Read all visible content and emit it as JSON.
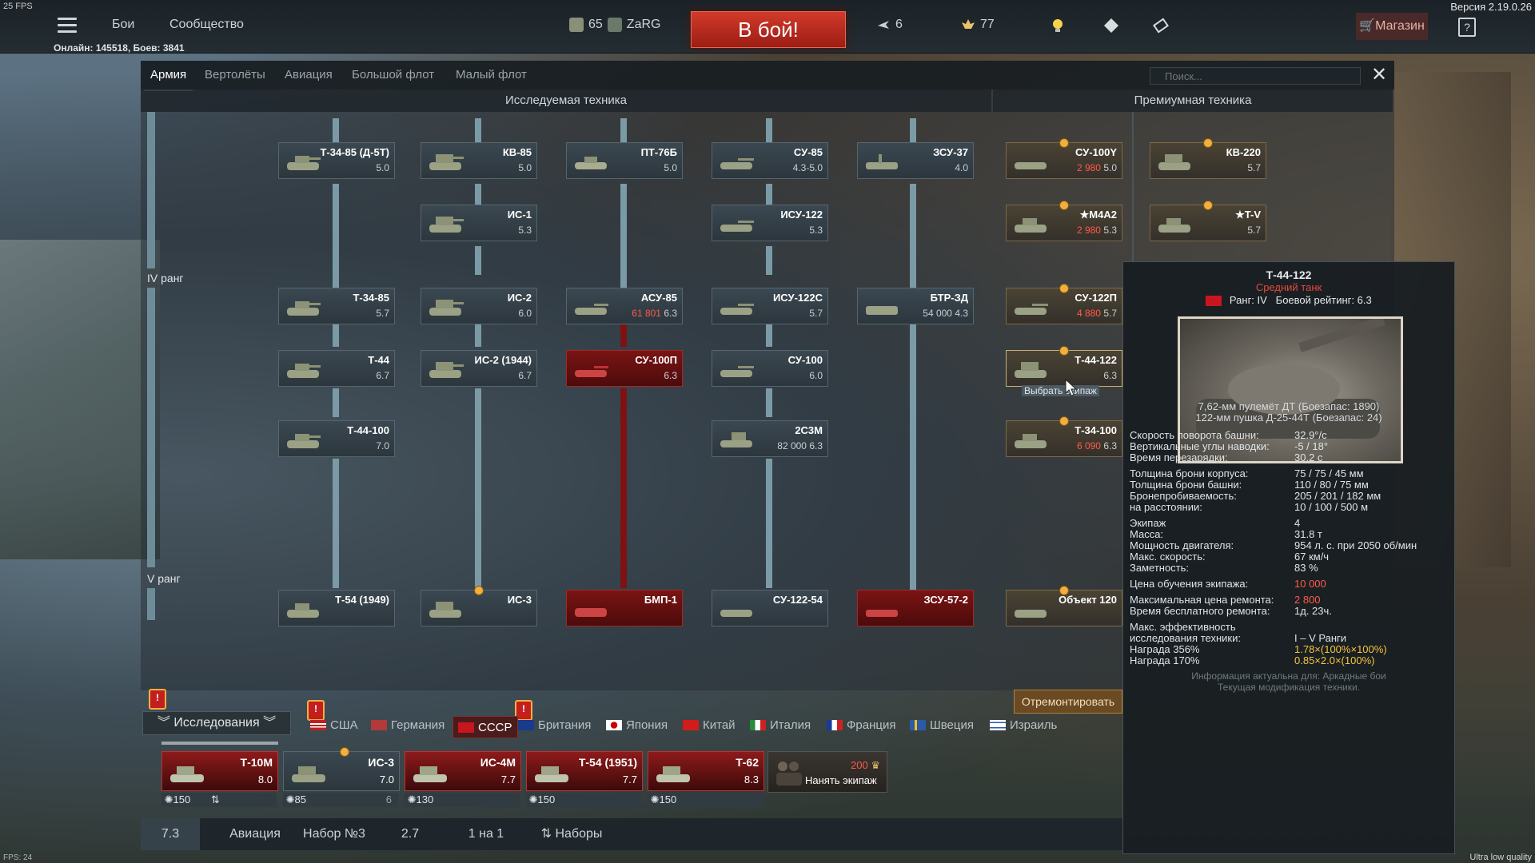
{
  "top": {
    "fps": "25 FPS",
    "version": "Версия 2.19.0.26",
    "nav": [
      "Бои",
      "Сообщество"
    ],
    "level": "65",
    "nickname": "ZaRG",
    "to_battle": "В бой!",
    "premium_count": "6",
    "eagles": "77",
    "shop": "Магазин",
    "help": "?",
    "online": "Онлайн: 145518, Боев: 3841"
  },
  "tabs": [
    "Армия",
    "Вертолёты",
    "Авиация",
    "Большой флот",
    "Малый флот"
  ],
  "search_placeholder": "Поиск...",
  "sections": {
    "research": "Исследуемая техника",
    "premium": "Премиумная техника"
  },
  "ranks": {
    "iv": "IV ранг",
    "v": "V ранг"
  },
  "vehicles": [
    {
      "name": "Т-34-85 (Д-5Т)",
      "br": "5.0"
    },
    {
      "name": "КВ-85",
      "br": "5.0"
    },
    {
      "name": "ПТ-76Б",
      "br": "5.0"
    },
    {
      "name": "СУ-85",
      "br": "4.3-5.0"
    },
    {
      "name": "ЗСУ-37",
      "br": "4.0"
    },
    {
      "name": "ИС-1",
      "br": "5.3"
    },
    {
      "name": "ИСУ-122",
      "br": "5.3"
    },
    {
      "name": "Т-34-85",
      "br": "5.7"
    },
    {
      "name": "ИС-2",
      "br": "6.0"
    },
    {
      "name": "АСУ-85",
      "cost": "61 801",
      "br": "6.3"
    },
    {
      "name": "ИСУ-122С",
      "br": "5.7"
    },
    {
      "name": "БТР-ЗД",
      "cost": "54 000",
      "br": "4.3"
    },
    {
      "name": "Т-44",
      "br": "6.7"
    },
    {
      "name": "ИС-2 (1944)",
      "br": "6.7"
    },
    {
      "name": "СУ-100П",
      "br": "6.3"
    },
    {
      "name": "СУ-100",
      "br": "6.0"
    },
    {
      "name": "Т-44-100",
      "br": "7.0"
    },
    {
      "name": "2С3М",
      "cost": "82 000",
      "br": "6.3"
    },
    {
      "name": "Т-54 (1949)",
      "br": ""
    },
    {
      "name": "ИС-3",
      "br": ""
    },
    {
      "name": "БМП-1",
      "br": ""
    },
    {
      "name": "СУ-122-54",
      "br": ""
    },
    {
      "name": "ЗСУ-57-2",
      "br": ""
    }
  ],
  "premium_vehicles": [
    {
      "name": "СУ-100Y",
      "cost": "2 980",
      "br": "5.0"
    },
    {
      "name": "КВ-220",
      "br": "5.7"
    },
    {
      "name": "★М4А2",
      "cost": "2 980",
      "br": "5.3"
    },
    {
      "name": "★T-V",
      "br": "5.7"
    },
    {
      "name": "СУ-122П",
      "cost": "4 880",
      "br": "5.7"
    },
    {
      "name": "Т-44-122",
      "br": "6.3",
      "sub": "Выбрать экипаж"
    },
    {
      "name": "Т-34-100",
      "cost": "6 090",
      "br": "6.3"
    },
    {
      "name": "Объект 120",
      "br": ""
    }
  ],
  "tooltip": {
    "title": "Т-44-122",
    "type": "Средний танк",
    "rank": "Ранг: IV",
    "rating": "Боевой рейтинг: 6.3",
    "arm1": "7,62-мм пулемёт ДТ (Боезапас: 1890)",
    "arm2": "122-мм пушка Д-25-44Т (Боезапас: 24)",
    "rows": [
      {
        "k": "Скорость поворота башни:",
        "v": "32.9°/с"
      },
      {
        "k": "Вертикальные углы наводки:",
        "v": "-5 / 18°"
      },
      {
        "k": "Время перезарядки:",
        "v": "30.2 с"
      },
      {
        "k": "Толщина брони корпуса:",
        "v": "75 / 75 / 45 мм"
      },
      {
        "k": "Толщина брони башни:",
        "v": "110 / 80 / 75 мм"
      },
      {
        "k": "Бронепробиваемость:",
        "v": "205 / 201 / 182 мм"
      },
      {
        "k": "на расстоянии:",
        "v": "10 / 100 / 500 м"
      },
      {
        "k": "Экипаж",
        "v": "4"
      },
      {
        "k": "Масса:",
        "v": "31.8 т"
      },
      {
        "k": "Мощность двигателя:",
        "v": "954 л. с. при 2050 об/мин"
      },
      {
        "k": "Макс. скорость:",
        "v": "67 км/ч"
      },
      {
        "k": "Заметность:",
        "v": "83 %"
      },
      {
        "k": "Цена обучения экипажа:",
        "v": "10 000"
      },
      {
        "k": "Максимальная цена ремонта:",
        "v": "2 800"
      },
      {
        "k": "Время бесплатного ремонта:",
        "v": "1д. 23ч."
      },
      {
        "k": "Макс. эффективность",
        "v": ""
      },
      {
        "k": "исследования техники:",
        "v": "I – V Ранги"
      },
      {
        "k": "Награда 356%",
        "v": "1.78×(100%×100%)"
      },
      {
        "k": "Награда 170%",
        "v": "0.85×2.0×(100%)"
      }
    ],
    "foot1": "Информация актуальна для: Аркадные бои",
    "foot2": "Текущая модификация техники."
  },
  "repair": "Отремонтировать",
  "research_dropdown": "Исследования",
  "nations": [
    "США",
    "Германия",
    "СССР",
    "Британия",
    "Япония",
    "Китай",
    "Италия",
    "Франция",
    "Швеция",
    "Израиль"
  ],
  "crew": [
    {
      "name": "Т-10М",
      "br": "8.0",
      "foot": "150"
    },
    {
      "name": "ИС-3",
      "br": "7.0",
      "foot": "85",
      "extra": "6"
    },
    {
      "name": "ИС-4М",
      "br": "7.7",
      "foot": "130"
    },
    {
      "name": "Т-54 (1951)",
      "br": "7.7",
      "foot": "150"
    },
    {
      "name": "Т-62",
      "br": "8.3",
      "foot": "150"
    }
  ],
  "hire": {
    "cost": "200",
    "label": "Нанять экипаж"
  },
  "bottom": [
    "7.3",
    "Авиация",
    "Набор №3",
    "2.7",
    "1 на 1",
    "Наборы"
  ],
  "fps_bottom": "FPS: 24",
  "quality": "Ultra low quality",
  "colors": {
    "accent_red": "#c8161e",
    "tree_line": "#7a9aa6",
    "cost_red": "#ff5a4a"
  }
}
